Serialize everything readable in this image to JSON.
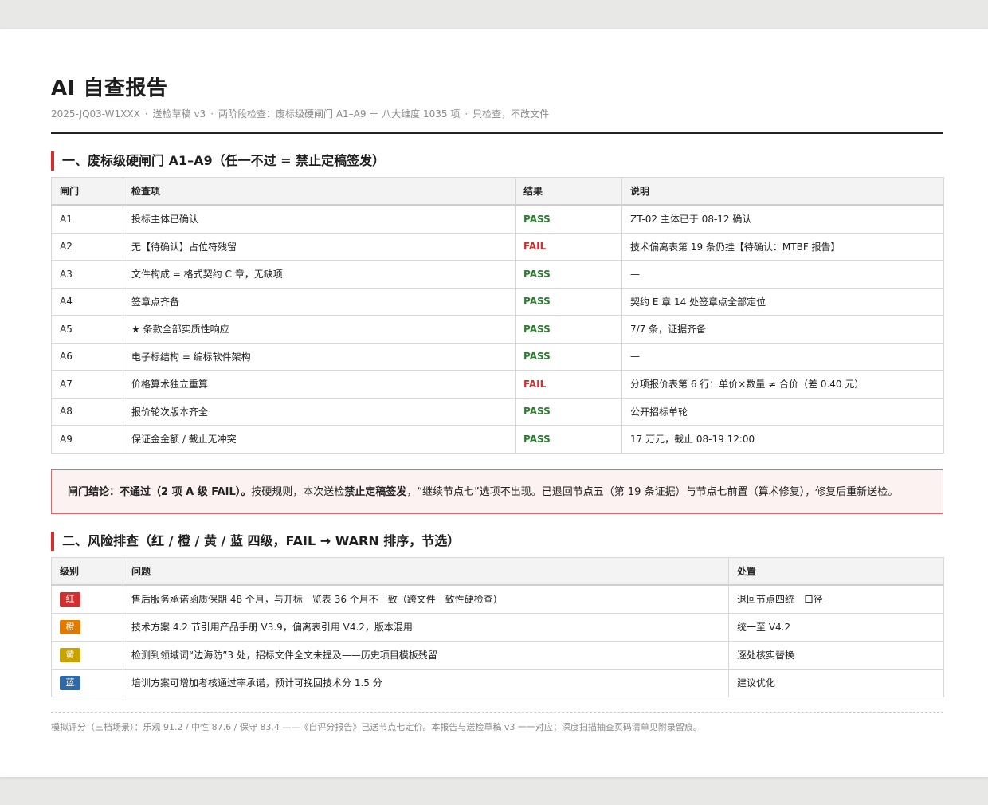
{
  "title": "AI 自查报告",
  "meta": {
    "doc_id": "2025-JQ03-W1XXX",
    "draft": "送检草稿 v3",
    "scope": "两阶段检查：废标级硬闸门 A1–A9 ＋ 八大维度 1035 项",
    "mode": "只检查，不改文件",
    "separator": "·"
  },
  "section1": {
    "title": "一、废标级硬闸门 A1–A9（任一不过 = 禁止定稿签发）",
    "headers": [
      "闸门",
      "检查项",
      "结果",
      "说明"
    ],
    "rows": [
      {
        "gate": "A1",
        "item": "投标主体已确认",
        "result": "PASS",
        "note": "ZT-02 主体已于 08-12 确认"
      },
      {
        "gate": "A2",
        "item": "无【待确认】占位符残留",
        "result": "FAIL",
        "note": "技术偏离表第 19 条仍挂【待确认：MTBF 报告】"
      },
      {
        "gate": "A3",
        "item": "文件构成 = 格式契约 C 章，无缺项",
        "result": "PASS",
        "note": "—"
      },
      {
        "gate": "A4",
        "item": "签章点齐备",
        "result": "PASS",
        "note": "契约 E 章 14 处签章点全部定位"
      },
      {
        "gate": "A5",
        "item": "★ 条款全部实质性响应",
        "result": "PASS",
        "note": "7/7 条，证据齐备"
      },
      {
        "gate": "A6",
        "item": "电子标结构 = 编标软件架构",
        "result": "PASS",
        "note": "—"
      },
      {
        "gate": "A7",
        "item": "价格算术独立重算",
        "result": "FAIL",
        "note": "分项报价表第 6 行：单价×数量 ≠ 合价（差 0.40 元）"
      },
      {
        "gate": "A8",
        "item": "报价轮次版本齐全",
        "result": "PASS",
        "note": "公开招标单轮"
      },
      {
        "gate": "A9",
        "item": "保证金金额 / 截止无冲突",
        "result": "PASS",
        "note": "17 万元，截止 08-19 12:00"
      }
    ]
  },
  "verdict": {
    "label": "闸门结论：不通过（2 项 A 级 FAIL）。",
    "text_a": "按硬规则，本次送检",
    "strong": "禁止定稿签发",
    "text_b": "，“继续节点七”选项不出现。已退回节点五（第 19 条证据）与节点七前置（算术修复），修复后重新送检。"
  },
  "section2": {
    "title": "二、风险排查（红 / 橙 / 黄 / 蓝 四级，FAIL → WARN 排序，节选）",
    "headers": [
      "级别",
      "问题",
      "处置"
    ],
    "rows": [
      {
        "level": "红",
        "color": "#d32f2f",
        "issue": "售后服务承诺函质保期 48 个月，与开标一览表 36 个月不一致（跨文件一致性硬检查）",
        "action": "退回节点四统一口径"
      },
      {
        "level": "橙",
        "color": "#e07b00",
        "issue": "技术方案 4.2 节引用产品手册 V3.9，偏离表引用 V4.2，版本混用",
        "action": "统一至 V4.2"
      },
      {
        "level": "黄",
        "color": "#c9a300",
        "issue": "检测到领域词“边海防”3 处，招标文件全文未提及——历史项目模板残留",
        "action": "逐处核实替换"
      },
      {
        "level": "蓝",
        "color": "#2f6aa8",
        "issue": "培训方案可增加考核通过率承诺，预计可挽回技术分 1.5 分",
        "action": "建议优化"
      }
    ]
  },
  "footer": "模拟评分（三档场景）：乐观 91.2 / 中性 87.6 / 保守 83.4 ——《自评分报告》已送节点七定价。本报告与送检草稿 v3 一一对应；深度扫描抽查页码清单见附录留痕。",
  "colors": {
    "pass": "#2e7d32",
    "fail": "#d32f2f",
    "accent": "#d32f2f"
  }
}
